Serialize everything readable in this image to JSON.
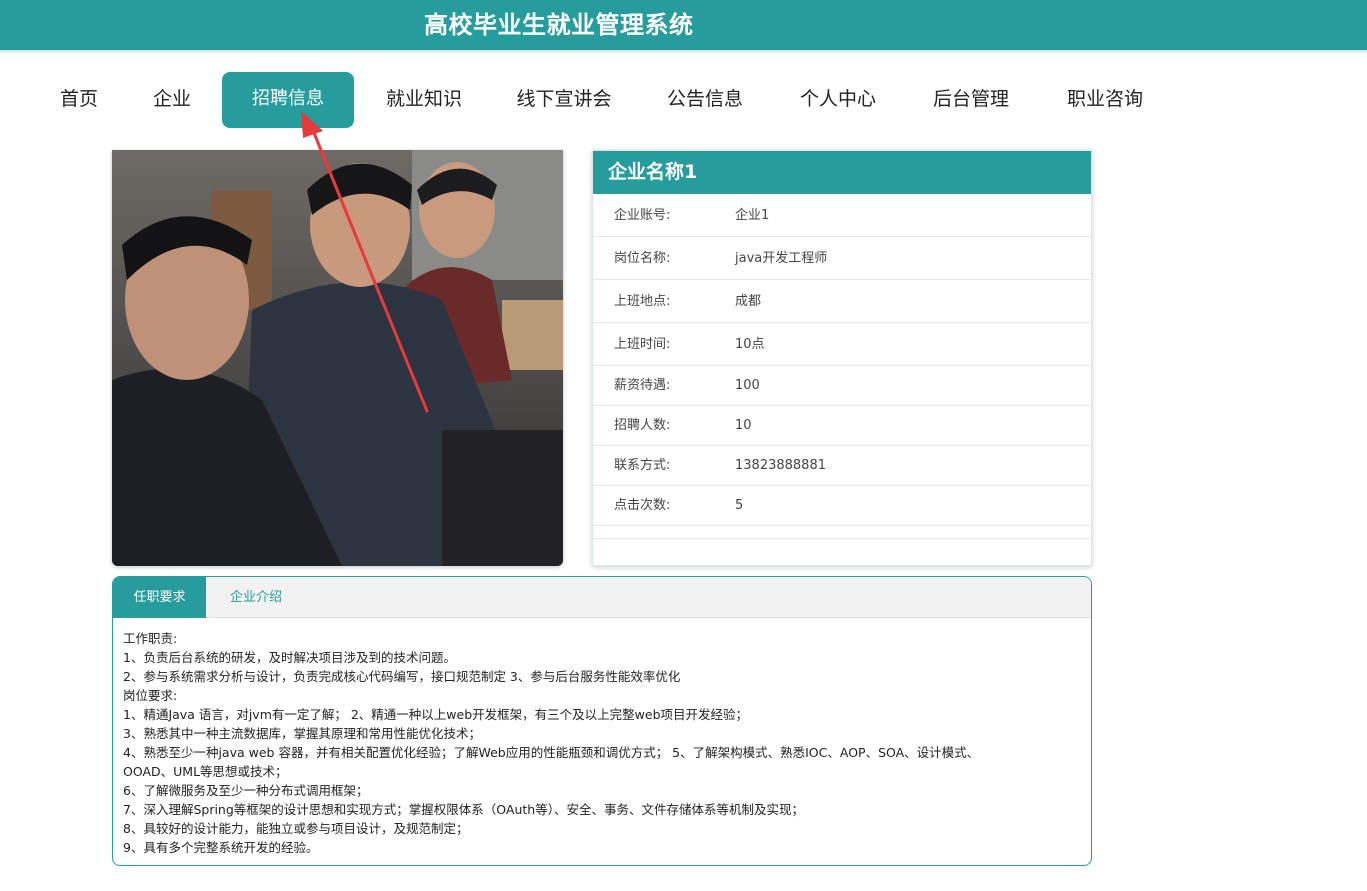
{
  "header": {
    "title": "高校毕业生就业管理系统"
  },
  "nav": {
    "items": [
      {
        "label": "首页"
      },
      {
        "label": "企业"
      },
      {
        "label": "招聘信息",
        "active": true
      },
      {
        "label": "就业知识"
      },
      {
        "label": "线下宣讲会"
      },
      {
        "label": "公告信息"
      },
      {
        "label": "个人中心"
      },
      {
        "label": "后台管理"
      },
      {
        "label": "职业咨询"
      }
    ]
  },
  "job": {
    "company_title": "企业名称1",
    "fields": [
      {
        "label": "企业账号:",
        "value": "企业1"
      },
      {
        "label": "岗位名称:",
        "value": "java开发工程师"
      },
      {
        "label": "上班地点:",
        "value": "成都"
      },
      {
        "label": "上班时间:",
        "value": "10点"
      },
      {
        "label": "薪资待遇:",
        "value": "100"
      },
      {
        "label": "招聘人数:",
        "value": "10"
      },
      {
        "label": "联系方式:",
        "value": "13823888881"
      },
      {
        "label": "点击次数:",
        "value": "5"
      }
    ]
  },
  "tabs": {
    "items": [
      {
        "label": "任职要求",
        "active": true
      },
      {
        "label": "企业介绍"
      }
    ],
    "content_lines": [
      "工作职责:",
      "1、负责后台系统的研发，及时解决项目涉及到的技术问题。",
      "2、参与系统需求分析与设计，负责完成核心代码编写，接口规范制定 3、参与后台服务性能效率优化",
      "岗位要求:",
      "1、精通Java 语言，对jvm有一定了解；  2、精通一种以上web开发框架，有三个及以上完整web项目开发经验；",
      "3、熟悉其中一种主流数据库，掌握其原理和常用性能优化技术；",
      "4、熟悉至少一种java web 容器，并有相关配置优化经验；了解Web应用的性能瓶颈和调优方式；  5、了解架构模式、熟悉IOC、AOP、SOA、设计模式、",
      "OOAD、UML等思想或技术；",
      "6、了解微服务及至少一种分布式调用框架；",
      "7、深入理解Spring等框架的设计思想和实现方式；掌握权限体系（OAuth等）、安全、事务、文件存储体系等机制及实现；",
      "8、具较好的设计能力，能独立或参与项目设计，及规范制定；",
      "9、具有多个完整系统开发的经验。"
    ]
  },
  "colors": {
    "primary": "#279c9c",
    "annotation": "#e83a3a"
  }
}
